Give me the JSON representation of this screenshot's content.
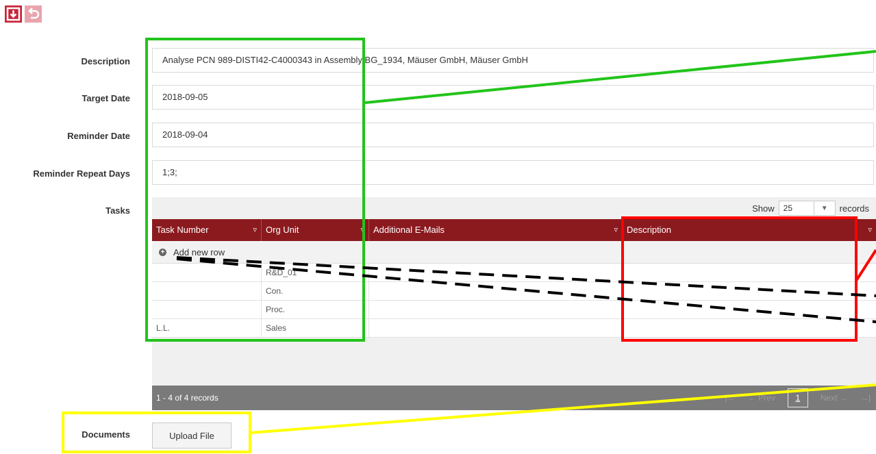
{
  "toolbar": {
    "save_icon": "save-icon",
    "undo_icon": "undo-icon",
    "accent": "#c8253a"
  },
  "form": {
    "description_label": "Description",
    "description_value": "Analyse PCN 989-DISTI42-C4000343 in Assembly BG_1934, Mäuser GmbH, Mäuser GmbH",
    "target_date_label": "Target Date",
    "target_date_value": "2018-09-05",
    "reminder_date_label": "Reminder Date",
    "reminder_date_value": "2018-09-04",
    "reminder_repeat_label": "Reminder Repeat Days",
    "reminder_repeat_value": "1;3;",
    "tasks_label": "Tasks",
    "documents_label": "Documents",
    "upload_label": "Upload File"
  },
  "grid": {
    "show_label": "Show",
    "page_size": "25",
    "records_label": "records",
    "columns": [
      "Task Number",
      "Org Unit",
      "Additional E-Mails",
      "Description"
    ],
    "add_row_label": "Add new row",
    "rows": [
      [
        "",
        "R&D_01",
        "",
        ""
      ],
      [
        "",
        "Con.",
        "",
        ""
      ],
      [
        "",
        "Proc.",
        "",
        ""
      ],
      [
        "L.L.",
        "Sales",
        "",
        ""
      ]
    ],
    "footer_count": "1 - 4 of 4 records",
    "pager_prev": "← Prev",
    "pager_page": "1",
    "pager_next": "Next →",
    "header_color": "#8b1a1f"
  },
  "annotations": {
    "green": "#22c41a",
    "red": "#ff0000",
    "yellow": "#ffff00"
  }
}
